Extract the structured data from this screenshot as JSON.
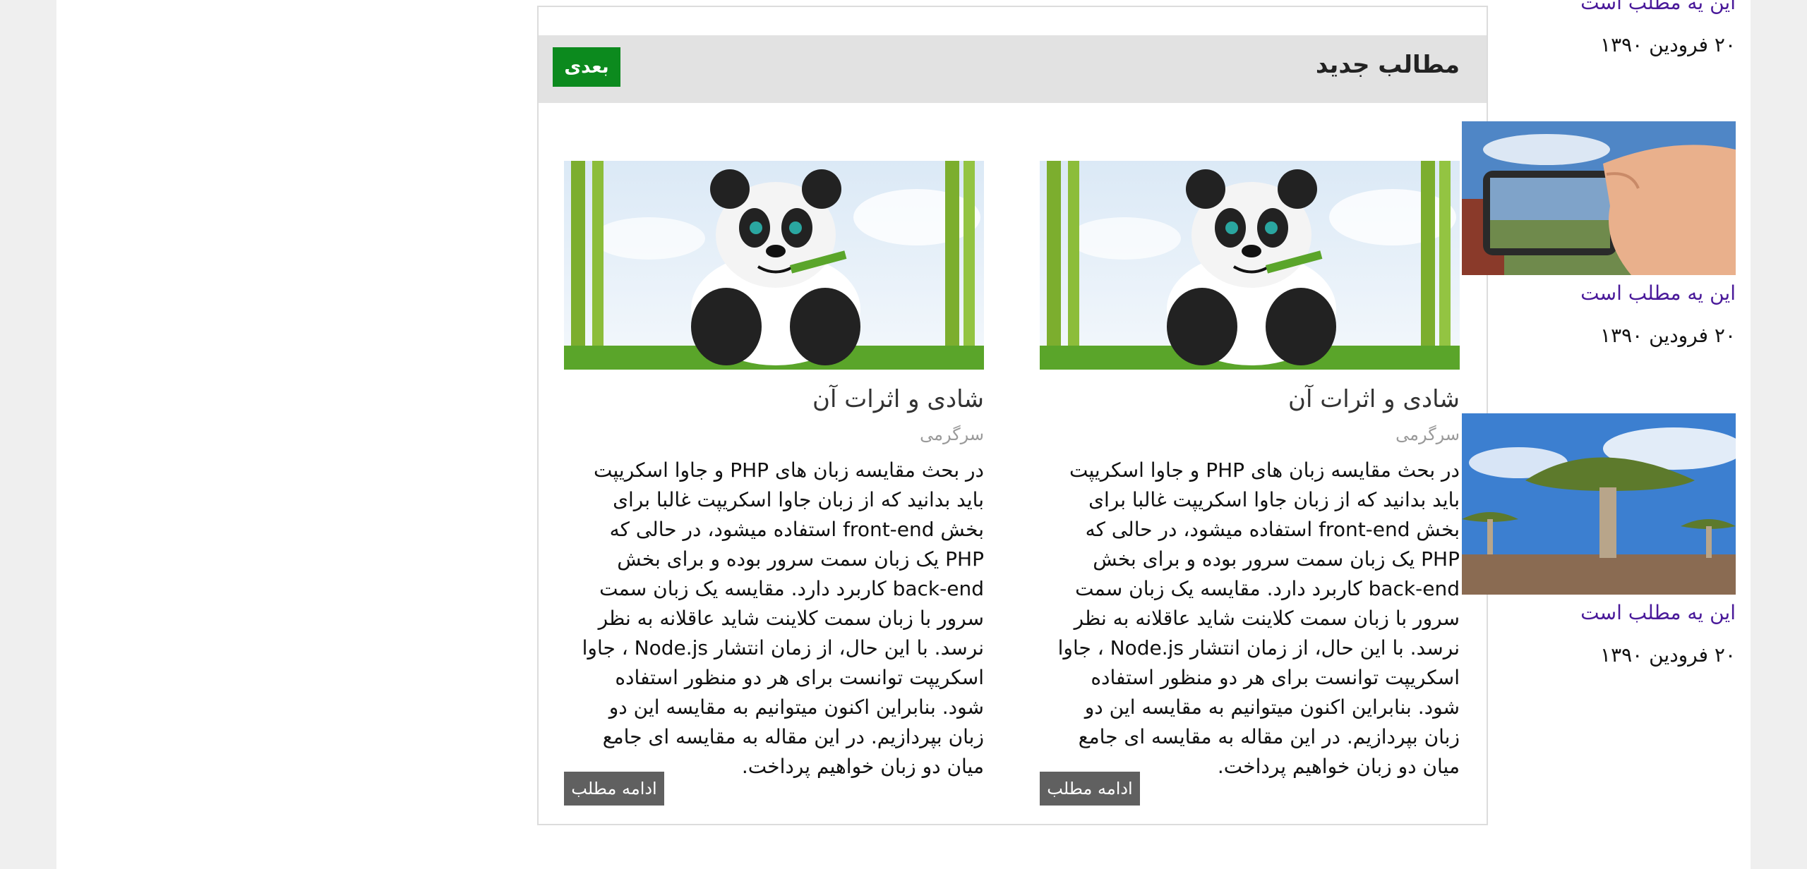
{
  "posts": {
    "title": "مطالب جدید",
    "next_label": "بعدی",
    "cards": [
      {
        "title": "شادی و اثرات آن",
        "category": "سرگرمی",
        "excerpt": "در بحث مقایسه زبان های PHP و جاوا اسکریپت باید بدانید که از زبان جاوا اسکریپت غالبا برای بخش front-end استفاده میشود، در حالی که PHP یک زبان سمت سرور بوده و برای بخش back-end کاربرد دارد. مقایسه یک زبان سمت سرور با زبان سمت کلاینت شاید عاقلانه به نظر نرسد. با این حال، از زمان انتشار Node.js ، جاوا اسکریپت توانست برای هر دو منظور استفاده شود. بنابراین اکنون میتوانیم به مقایسه این دو زبان بپردازیم. در این مقاله به مقایسه ای جامع میان دو زبان خواهیم پرداخت.",
        "read_more": "ادامه مطلب"
      },
      {
        "title": "شادی و اثرات آن",
        "category": "سرگرمی",
        "excerpt": "در بحث مقایسه زبان های PHP و جاوا اسکریپت باید بدانید که از زبان جاوا اسکریپت غالبا برای بخش front-end استفاده میشود، در حالی که PHP یک زبان سمت سرور بوده و برای بخش back-end کاربرد دارد. مقایسه یک زبان سمت سرور با زبان سمت کلاینت شاید عاقلانه به نظر نرسد. با این حال، از زمان انتشار Node.js ، جاوا اسکریپت توانست برای هر دو منظور استفاده شود. بنابراین اکنون میتوانیم به مقایسه این دو زبان بپردازیم. در این مقاله به مقایسه ای جامع میان دو زبان خواهیم پرداخت.",
        "read_more": "ادامه مطلب"
      }
    ]
  },
  "sidebar": {
    "items": [
      {
        "title": "این یه مطلب است",
        "date": "۲۰ فرودین ۱۳۹۰"
      },
      {
        "title": "این یه مطلب است",
        "date": "۲۰ فرودین ۱۳۹۰"
      },
      {
        "title": "این یه مطلب است",
        "date": "۲۰ فرودین ۱۳۹۰"
      }
    ]
  },
  "colors": {
    "next_button": "#0c8a1e",
    "read_more_button": "#606060",
    "sidebar_link": "#4a1a9a"
  }
}
